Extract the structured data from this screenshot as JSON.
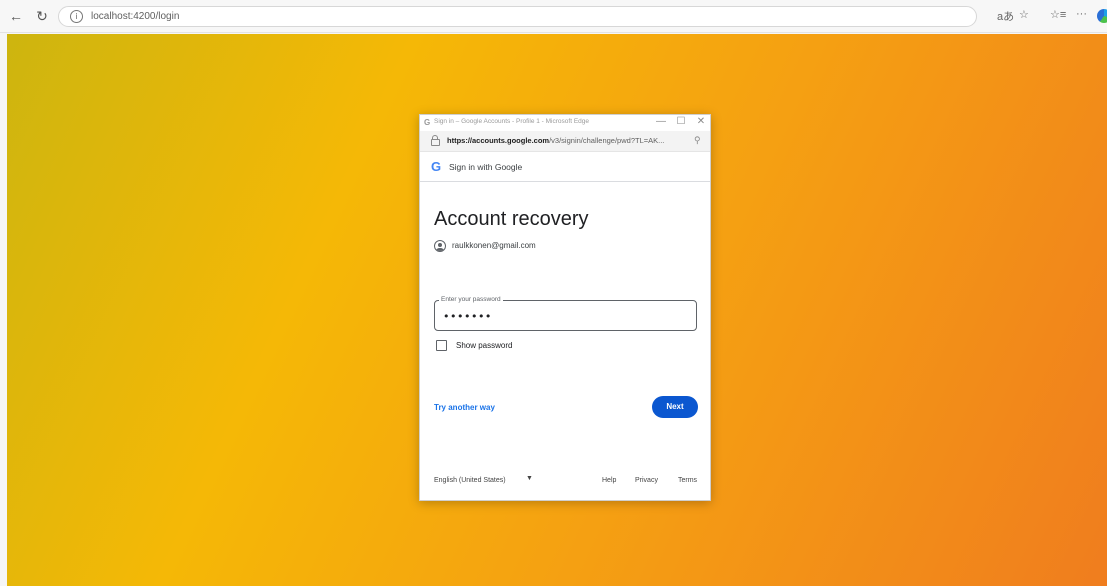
{
  "browser": {
    "back_icon": "←",
    "refresh_icon": "↻",
    "url": "localhost:4200/login",
    "right_icons": {
      "read_aloud": "aあ",
      "favorite": "☆",
      "favorites_list": "☆≡",
      "more": "···"
    }
  },
  "popup": {
    "window_title": "Sign in – Google Accounts - Profile 1 - Microsoft Edge",
    "window_controls": {
      "minimize": "—",
      "maximize": "☐",
      "close": "✕"
    },
    "url_host": "https://accounts.google.com",
    "url_path": "/v3/signin/challenge/pwd?TL=AK...",
    "header_text": "Sign in with Google",
    "heading": "Account recovery",
    "account_email": "raulkkonen@gmail.com",
    "password_label": "Enter your password",
    "password_value": "•••••••",
    "show_password_label": "Show password",
    "try_another_way": "Try another way",
    "next_button": "Next",
    "footer": {
      "language": "English (United States)",
      "help": "Help",
      "privacy": "Privacy",
      "terms": "Terms"
    }
  },
  "colors": {
    "google_blue": "#0b57d0",
    "link_blue": "#1a73e8",
    "background_gradient": [
      "#cdb50f",
      "#f5b806",
      "#f5a012",
      "#f07d1e"
    ]
  }
}
